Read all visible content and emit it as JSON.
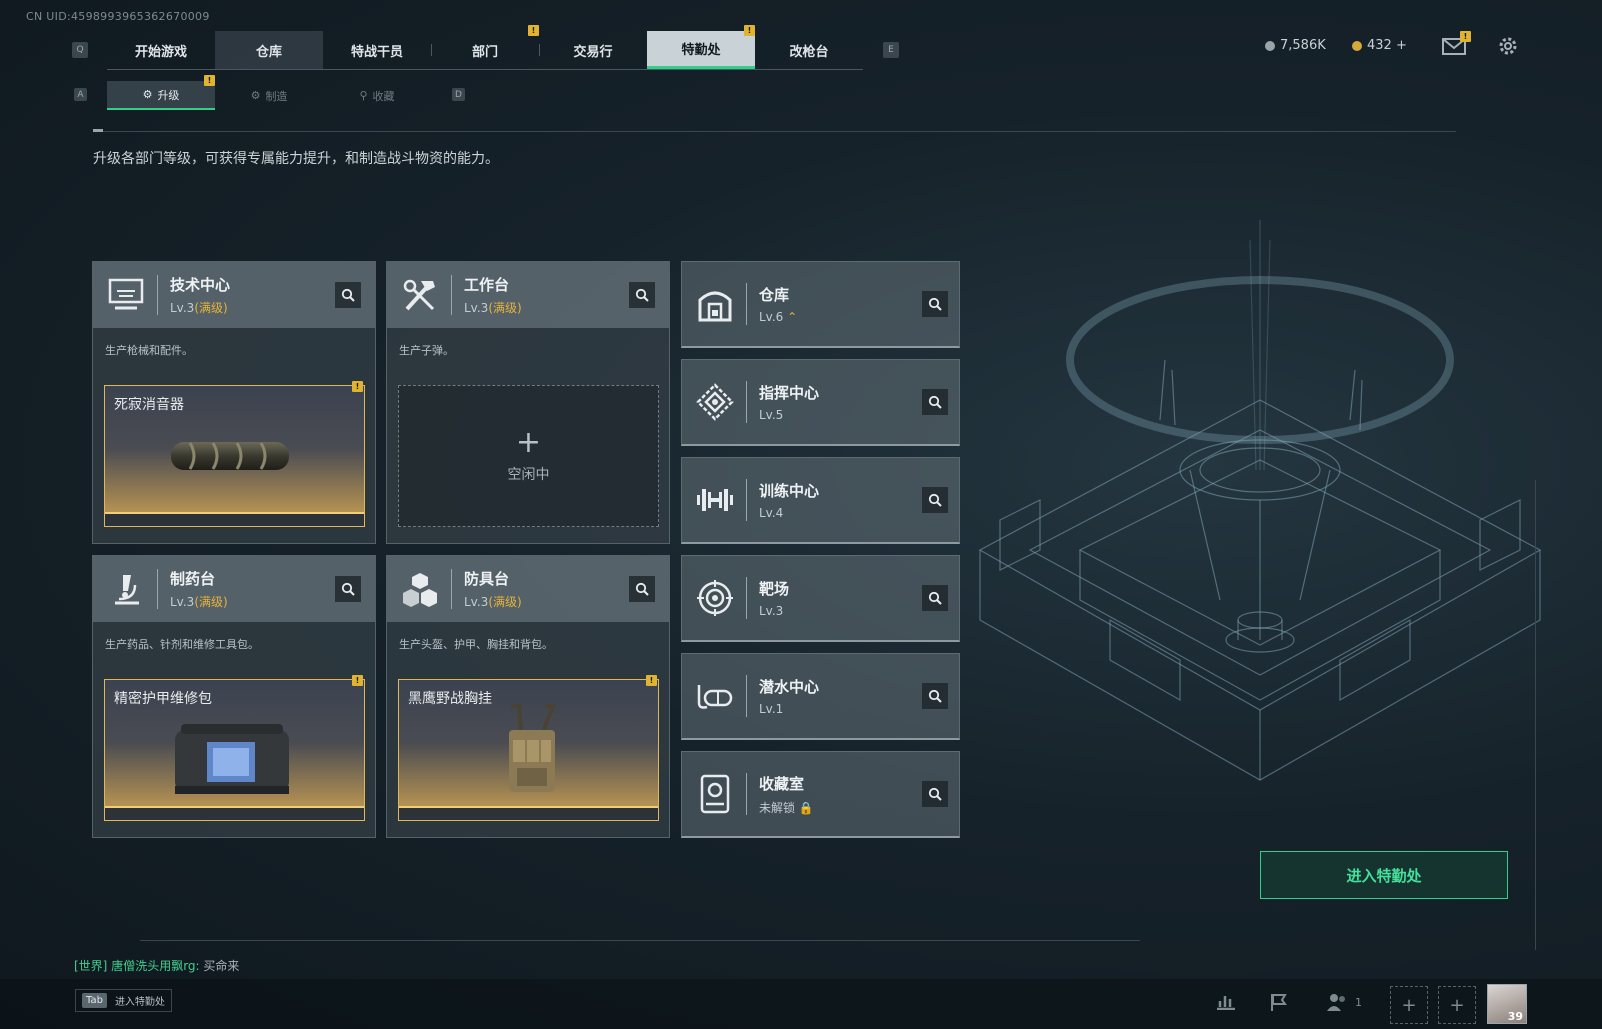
{
  "uid": "CN UID:4598993965362670009",
  "nav": {
    "key_left": "Q",
    "key_right": "E",
    "tabs": [
      {
        "label": "开始游戏"
      },
      {
        "label": "仓库"
      },
      {
        "label": "特战干员"
      },
      {
        "label": "部门"
      },
      {
        "label": "交易行"
      },
      {
        "label": "特勤处"
      },
      {
        "label": "改枪台"
      }
    ],
    "badge": "!"
  },
  "sub_nav": {
    "key_left": "A",
    "key_right": "D",
    "tabs": [
      {
        "label": "升级"
      },
      {
        "label": "制造"
      },
      {
        "label": "收藏"
      }
    ]
  },
  "currency": {
    "silver": "7,586K",
    "gold": "432 +"
  },
  "description": "升级各部门等级，可获得专属能力提升，和制造战斗物资的能力。",
  "workshops": [
    {
      "name": "技术中心",
      "level": "Lv.3",
      "max": "(满级)",
      "desc": "生产枪械和配件。",
      "slot": "死寂消音器",
      "icon": "computer-icon"
    },
    {
      "name": "工作台",
      "level": "Lv.3",
      "max": "(满级)",
      "desc": "生产子弹。",
      "slot_idle": "空闲中",
      "icon": "tools-icon"
    },
    {
      "name": "制药台",
      "level": "Lv.3",
      "max": "(满级)",
      "desc": "生产药品、针剂和维修工具包。",
      "slot": "精密护甲维修包",
      "icon": "microscope-icon"
    },
    {
      "name": "防具台",
      "level": "Lv.3",
      "max": "(满级)",
      "desc": "生产头盔、护甲、胸挂和背包。",
      "slot": "黑鹰野战胸挂",
      "icon": "boxes-icon"
    }
  ],
  "facilities": [
    {
      "name": "仓库",
      "level": "Lv.6",
      "icon": "warehouse-icon"
    },
    {
      "name": "指挥中心",
      "level": "Lv.5",
      "icon": "command-icon"
    },
    {
      "name": "训练中心",
      "level": "Lv.4",
      "icon": "dumbbell-icon"
    },
    {
      "name": "靶场",
      "level": "Lv.3",
      "icon": "target-icon"
    },
    {
      "name": "潜水中心",
      "level": "Lv.1",
      "icon": "diving-mask-icon"
    },
    {
      "name": "收藏室",
      "level": "未解锁",
      "icon": "collection-icon"
    }
  ],
  "enter_button": "进入特勤处",
  "chat": {
    "channel": "[世界]",
    "user": "唐僧洗头用飘rg:",
    "message": "买命来"
  },
  "bottom": {
    "tab_key": "Tab",
    "tab_label": "进入特勤处",
    "friends_count": "1",
    "level": "39"
  },
  "colors": {
    "accent_green": "#2fd08a",
    "gold": "#e6b33a",
    "badge": "#e0b432"
  }
}
